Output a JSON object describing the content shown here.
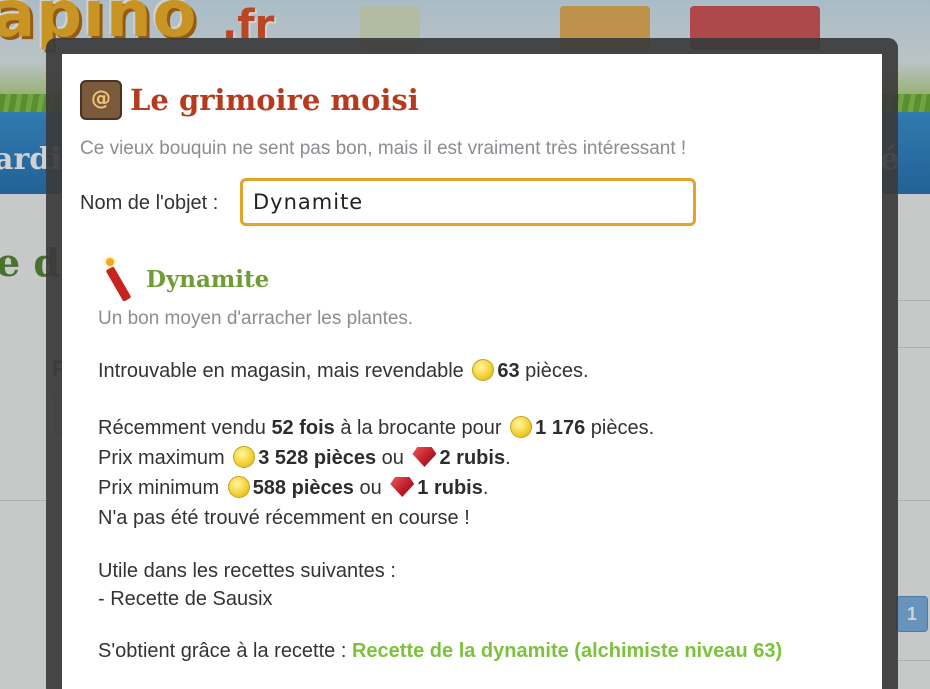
{
  "background": {
    "logo": "apino",
    "logo_suffix": ".fr",
    "nav_left_text": "ardi",
    "nav_right_text": "é",
    "title_fragment": "e d",
    "page_button": "1"
  },
  "dialog": {
    "title": "Le grimoire moisi",
    "subtitle": "Ce vieux bouquin ne sent pas bon, mais il est vraiment très intéressant !",
    "name_label": "Nom de l'objet :",
    "name_value": "Dynamite",
    "item": {
      "name": "Dynamite",
      "description": "Un bon moyen d'arracher les plantes.",
      "shop_text": "Introuvable en magasin, mais revendable",
      "resale_price": "63",
      "coins_unit": "pièces.",
      "recent_prefix": "Récemment vendu",
      "recent_count": "52 fois",
      "recent_mid": "à la brocante pour",
      "recent_price": "1 176",
      "recent_unit": "pièces.",
      "max_label": "Prix maximum",
      "max_coins": "3 528 pièces",
      "or_text": "ou",
      "max_rubies": "2 rubis",
      "min_label": "Prix minimum",
      "min_coins": "588 pièces",
      "min_rubies": "1 rubis",
      "period": ".",
      "race_text": "N'a pas été trouvé récemment en course !",
      "recipes_heading": "Utile dans les recettes suivantes :",
      "recipes": [
        "- Recette de Sausix"
      ],
      "obtained_label": "S'obtient grâce à la recette :",
      "obtained_recipe": "Recette de la dynamite (alchimiste niveau 63)"
    }
  },
  "icons": {
    "book": "grimoire-book-icon",
    "dynamite": "dynamite-icon",
    "coin": "gold-coin-icon",
    "ruby": "ruby-icon"
  },
  "colors": {
    "title": "#b53a1e",
    "item_name": "#6f9c35",
    "input_border": "#e2a52a",
    "recipe_link": "#7cc23d",
    "nav_blue": "#2a78b8"
  }
}
